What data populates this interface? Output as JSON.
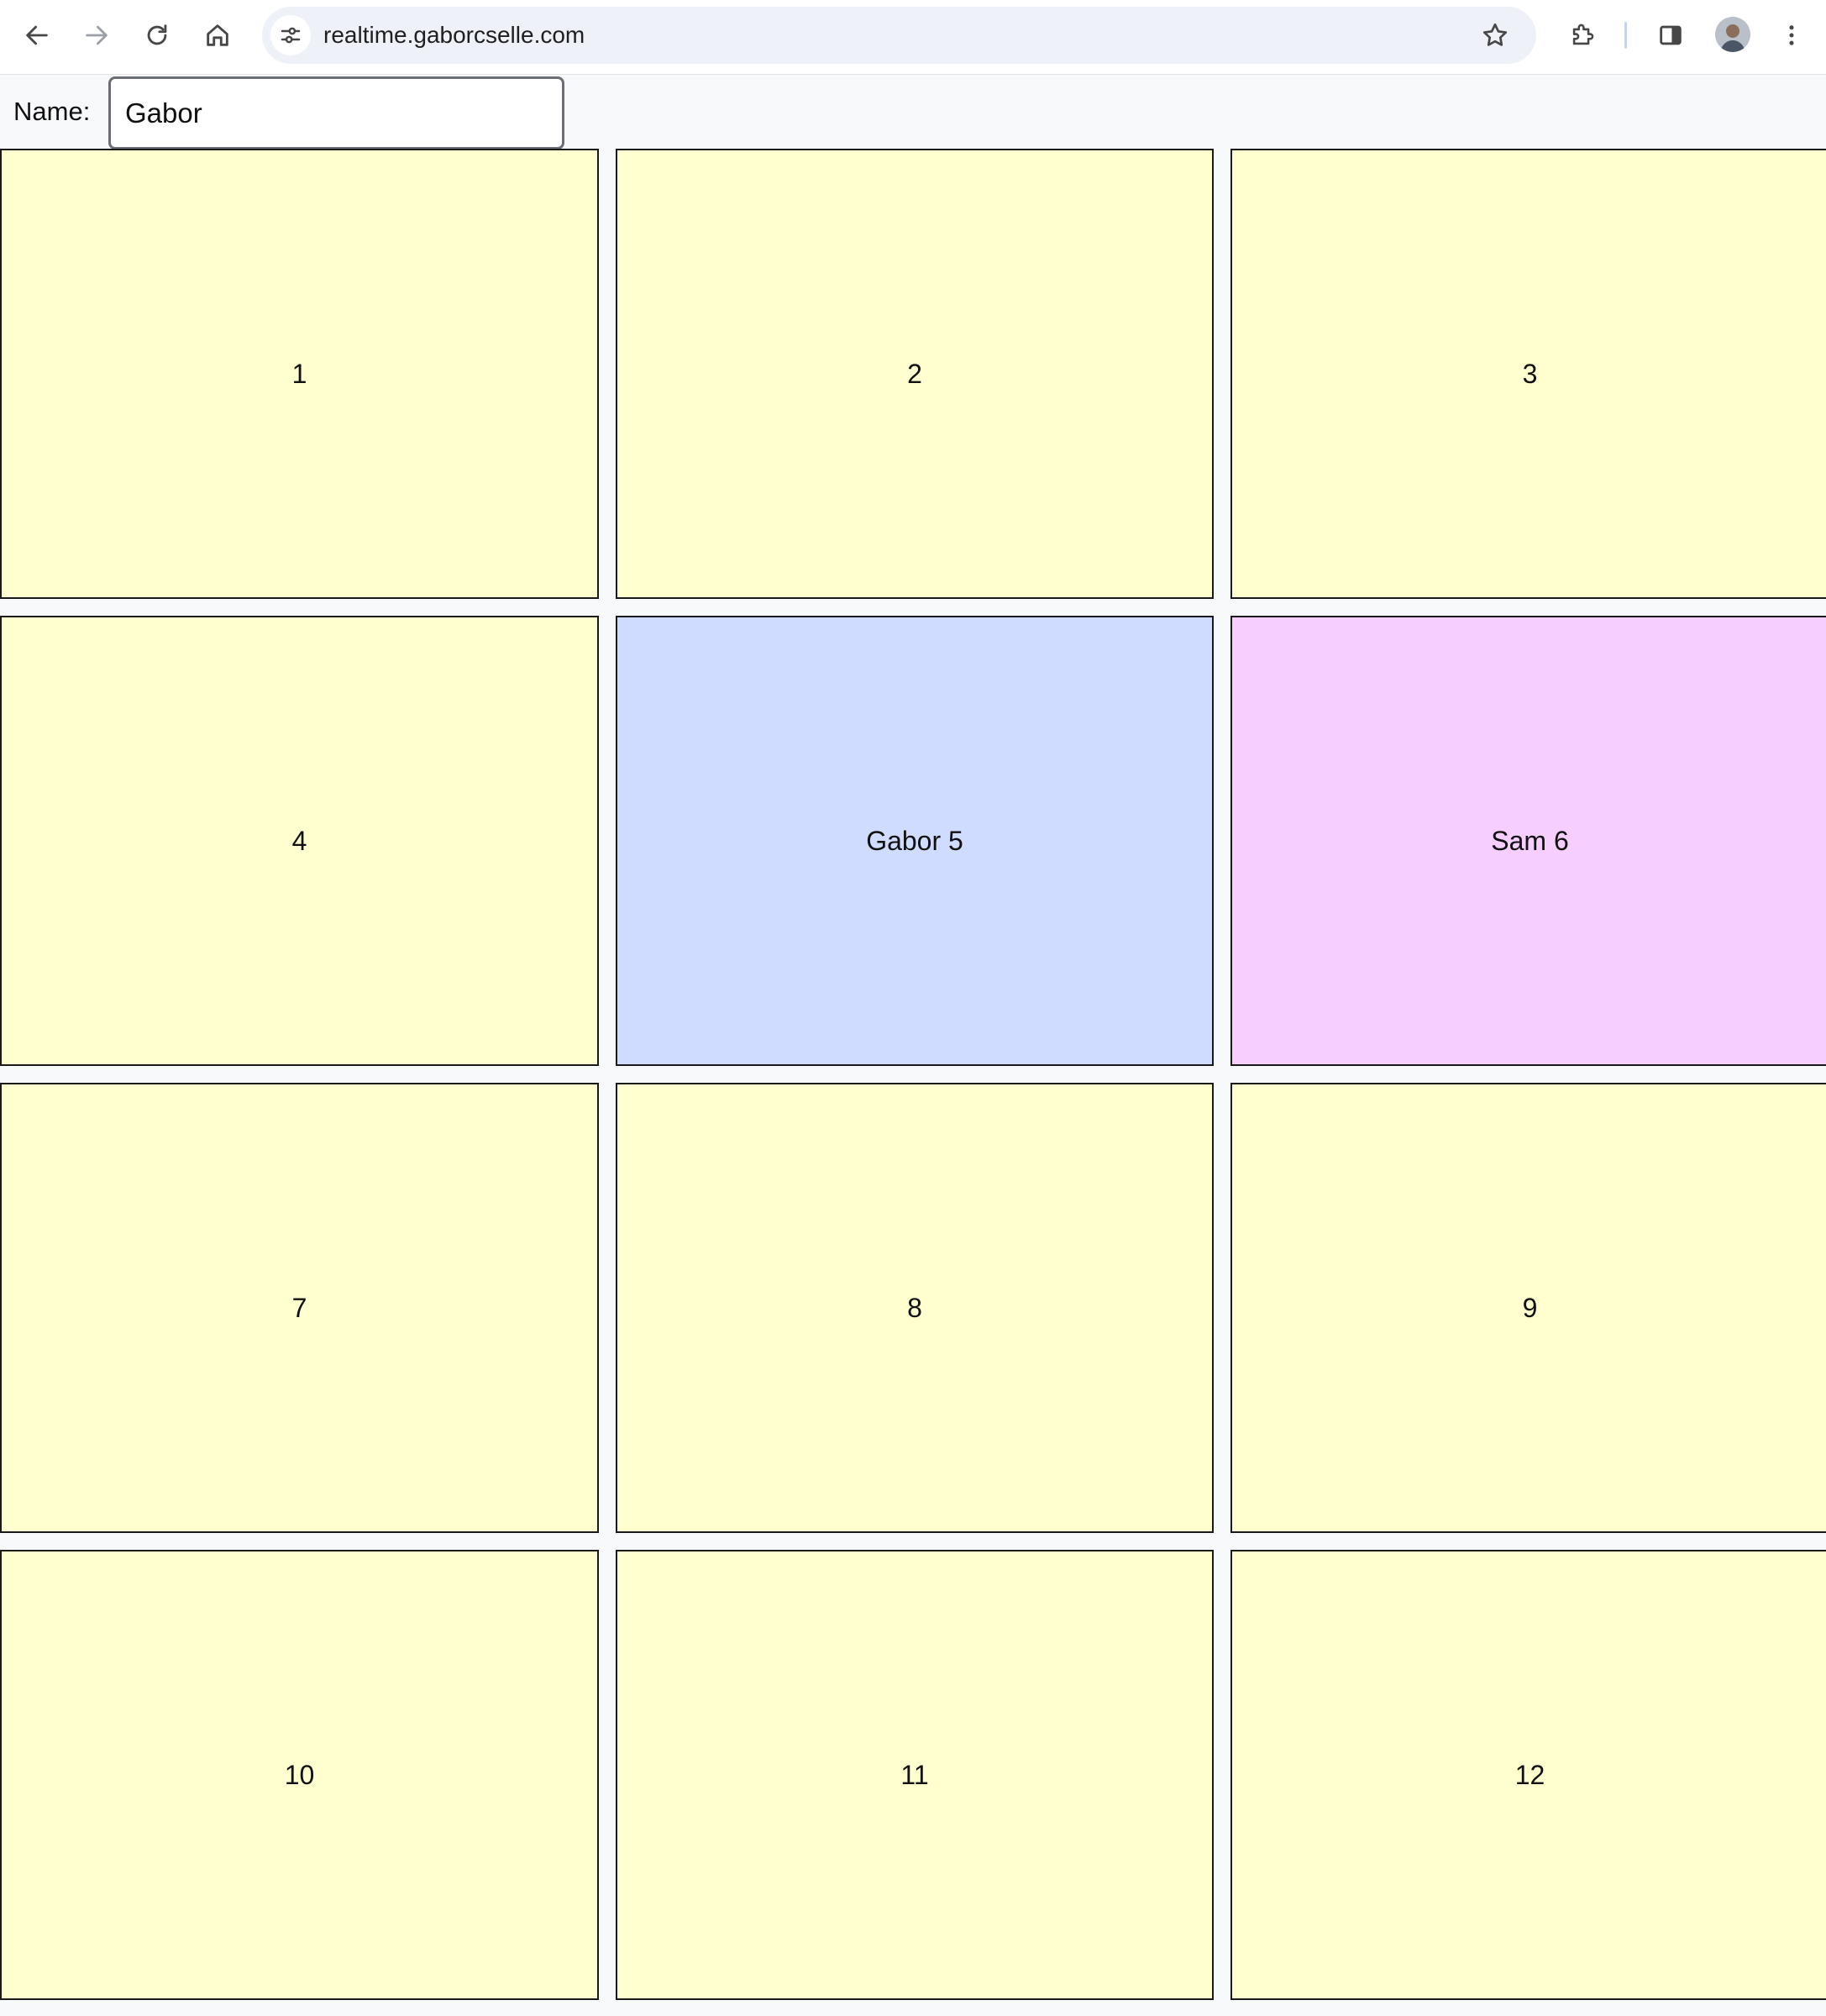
{
  "browser": {
    "url": "realtime.gaborcselle.com",
    "icons": {
      "back": "arrow-left-icon",
      "forward": "arrow-right-icon",
      "reload": "reload-icon",
      "home": "home-icon",
      "site_info": "tune-icon",
      "bookmark": "star-icon",
      "extensions": "puzzle-icon",
      "side_panel": "side-panel-icon",
      "profile": "avatar",
      "menu": "kebab-menu-icon"
    }
  },
  "form": {
    "name_label": "Name:",
    "name_value": "Gabor"
  },
  "colors": {
    "cell_default": "#ffffcf",
    "cell_gabor": "#d0dcff",
    "cell_sam": "#f6ceff"
  },
  "cells": [
    {
      "label": "1",
      "state": "empty"
    },
    {
      "label": "2",
      "state": "empty"
    },
    {
      "label": "3",
      "state": "empty"
    },
    {
      "label": "4",
      "state": "empty"
    },
    {
      "label": "Gabor 5",
      "state": "gabor"
    },
    {
      "label": "Sam 6",
      "state": "sam"
    },
    {
      "label": "7",
      "state": "empty"
    },
    {
      "label": "8",
      "state": "empty"
    },
    {
      "label": "9",
      "state": "empty"
    },
    {
      "label": "10",
      "state": "empty"
    },
    {
      "label": "11",
      "state": "empty"
    },
    {
      "label": "12",
      "state": "empty"
    }
  ]
}
